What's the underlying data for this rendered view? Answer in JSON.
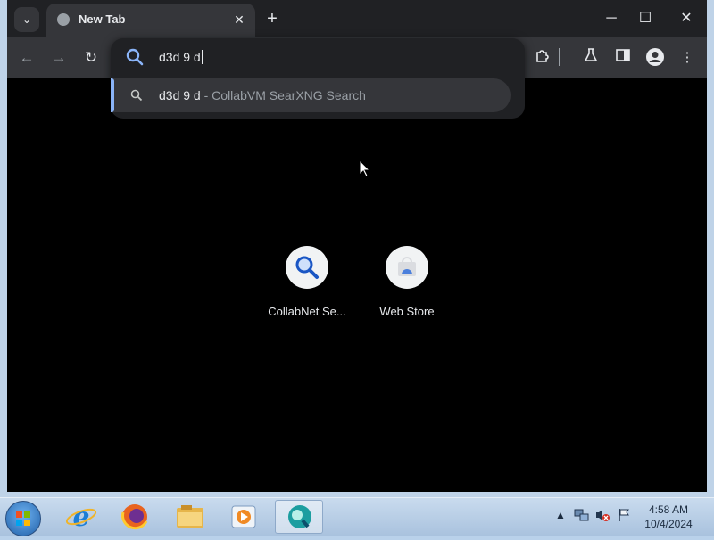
{
  "browser": {
    "tab": {
      "title": "New Tab",
      "close": "✕"
    },
    "new_tab": "+",
    "window_controls": {
      "minimize": "─",
      "maximize": "☐",
      "close": "✕"
    },
    "toolbar": {
      "back": "←",
      "forward": "→",
      "reload": "↻",
      "more": "⋮"
    },
    "tab_search": "⌄"
  },
  "omnibox": {
    "query": "d3d 9 d",
    "suggestions": [
      {
        "query": "d3d 9 d",
        "separator": " - ",
        "engine": "CollabVM SearXNG Search",
        "icon": "search-icon"
      }
    ]
  },
  "shortcuts": [
    {
      "label": "CollabNet Se...",
      "icon": "magnifier-icon"
    },
    {
      "label": "Web Store",
      "icon": "web-store-icon"
    }
  ],
  "taskbar": {
    "apps": [
      "internet-explorer-icon",
      "firefox-icon",
      "file-explorer-icon",
      "media-player-icon",
      "browser-app-icon"
    ],
    "clock": {
      "time": "4:58 AM",
      "date": "10/4/2024"
    },
    "tray_arrow": "▲"
  },
  "colors": {
    "accent": "#8ab4f8",
    "search_icon": "#8ab4f8",
    "toolbar_bg": "#35363a",
    "tabstrip_bg": "#202124"
  }
}
